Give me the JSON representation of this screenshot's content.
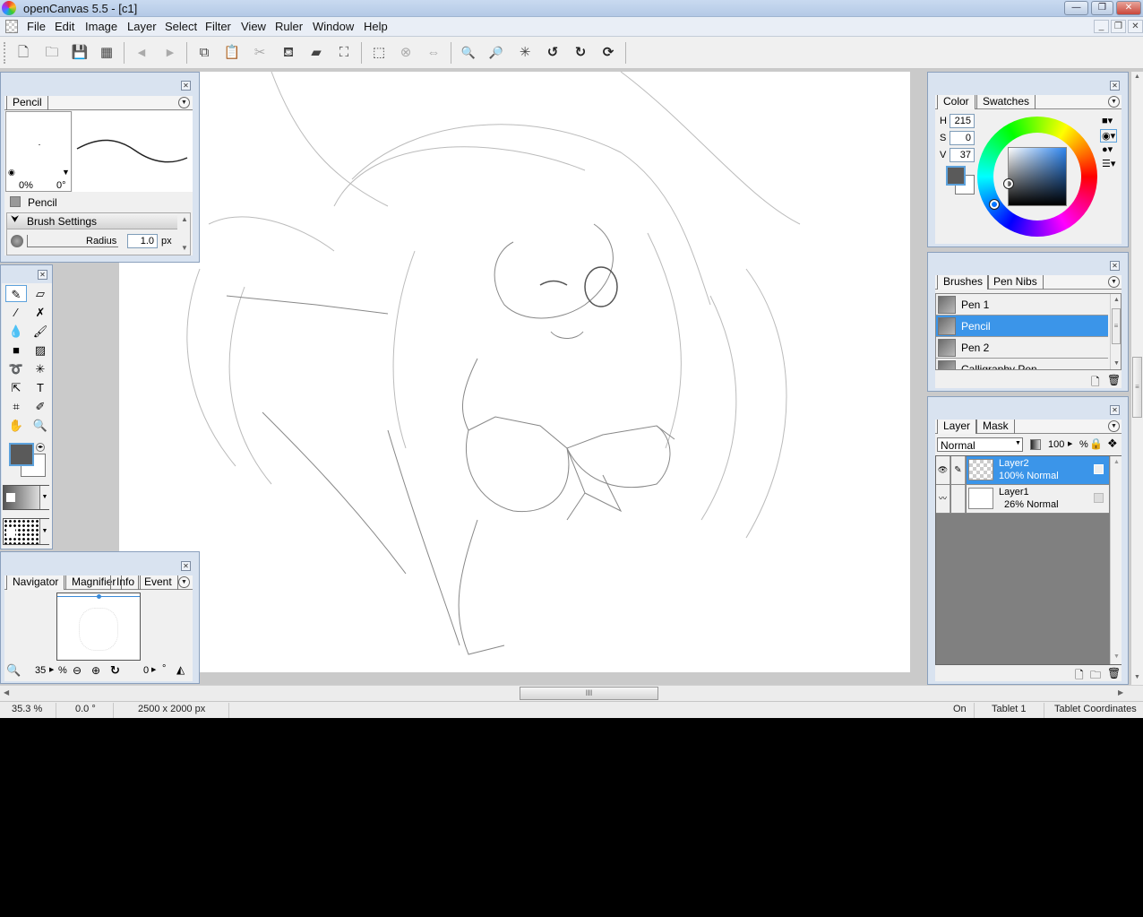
{
  "window": {
    "title": "openCanvas 5.5 - [c1]",
    "controls": {
      "minimize": "—",
      "restore": "❐",
      "close": "✕"
    },
    "mdi_controls": {
      "minimize": "_",
      "restore": "❐",
      "close": "✕"
    }
  },
  "menu": [
    "File",
    "Edit",
    "Image",
    "Layer",
    "Select",
    "Filter",
    "View",
    "Ruler",
    "Window",
    "Help"
  ],
  "toolbar": {
    "buttons": [
      {
        "name": "new-file",
        "glyph": "🗋"
      },
      {
        "name": "open-folder",
        "glyph": "🗀"
      },
      {
        "name": "save",
        "glyph": "💾"
      },
      {
        "name": "save-as",
        "glyph": "▦"
      },
      {
        "name": "step-back",
        "glyph": "◀"
      },
      {
        "name": "step-forward",
        "glyph": "▶"
      },
      {
        "name": "copy",
        "glyph": "⧉"
      },
      {
        "name": "paste",
        "glyph": "📋"
      },
      {
        "name": "cut",
        "glyph": "✂"
      },
      {
        "name": "fill",
        "glyph": "⛾"
      },
      {
        "name": "eraser",
        "glyph": "▰"
      },
      {
        "name": "transform",
        "glyph": "⛶"
      },
      {
        "name": "select-all",
        "glyph": "⬚"
      },
      {
        "name": "deselect",
        "glyph": "⊗"
      },
      {
        "name": "invert-selection",
        "glyph": "⇔"
      },
      {
        "name": "zoom-in",
        "glyph": "🔍"
      },
      {
        "name": "zoom-out",
        "glyph": "🔎"
      },
      {
        "name": "fit-view",
        "glyph": "✳"
      },
      {
        "name": "rotate-left",
        "glyph": "↺"
      },
      {
        "name": "rotate-right",
        "glyph": "↻"
      },
      {
        "name": "reset-rotation",
        "glyph": "⟳"
      }
    ]
  },
  "brush_panel": {
    "tab": "Pencil",
    "preview_opacity": "0%",
    "preview_angle": "0°",
    "brush_name": "Pencil",
    "section": "Brush Settings",
    "radius_label": "Radius",
    "radius_value": "1.0",
    "radius_unit": "px"
  },
  "tools": {
    "rows": [
      [
        "pencil",
        "eraser"
      ],
      [
        "brush",
        "blur"
      ],
      [
        "water",
        "airbrush"
      ],
      [
        "fill",
        "gradient"
      ],
      [
        "lasso",
        "magic-wand"
      ],
      [
        "move",
        "text"
      ],
      [
        "crop",
        "eyedropper"
      ],
      [
        "hand",
        "zoom"
      ]
    ],
    "glyphs": {
      "pencil": "✎",
      "eraser": "▱",
      "brush": "⁄",
      "blur": "✗",
      "water": "💧",
      "airbrush": "🖌",
      "fill": "■",
      "gradient": "▨",
      "lasso": "➰",
      "magic-wand": "✳",
      "move": "⇱",
      "text": "T",
      "crop": "⌗",
      "eyedropper": "✐",
      "hand": "✋",
      "zoom": "🔍"
    },
    "foreground_color": "#5a5a5a",
    "background_color": "#ffffff"
  },
  "navigator": {
    "tabs": [
      "Navigator",
      "Magnifier",
      "Info",
      "Event"
    ],
    "zoom_value": "35",
    "zoom_unit": "%",
    "rotation_value": "0",
    "rotation_unit": "°"
  },
  "color_panel": {
    "tabs": [
      "Color",
      "Swatches"
    ],
    "h_label": "H",
    "h_value": "215",
    "s_label": "S",
    "s_value": "0",
    "v_label": "V",
    "v_value": "37",
    "foreground": "#5a5a5a",
    "background": "#ffffff"
  },
  "brushes_panel": {
    "tabs": [
      "Brushes",
      "Pen Nibs"
    ],
    "items": [
      {
        "label": "Pen 1",
        "selected": false
      },
      {
        "label": "Pencil",
        "selected": true
      },
      {
        "label": "Pen 2",
        "selected": false
      },
      {
        "label": "Calligraphy Pen",
        "selected": false
      }
    ]
  },
  "layer_panel": {
    "tabs": [
      "Layer",
      "Mask"
    ],
    "blend_mode": "Normal",
    "opacity": "100",
    "opacity_unit": "%",
    "layers": [
      {
        "name": "Layer2",
        "info": "100% Normal",
        "selected": true
      },
      {
        "name": "Layer1",
        "info": "26% Normal",
        "selected": false
      }
    ]
  },
  "status": {
    "zoom": "35.3 %",
    "rotation": "0.0 °",
    "size": "2500 x 2000 px",
    "tablet_state": "On",
    "tablet_name": "Tablet 1",
    "coords": "Tablet Coordinates"
  },
  "colors": {
    "accent": "#3b95e9",
    "panel_bg": "#d9e3f0",
    "workspace": "#cacaca"
  }
}
